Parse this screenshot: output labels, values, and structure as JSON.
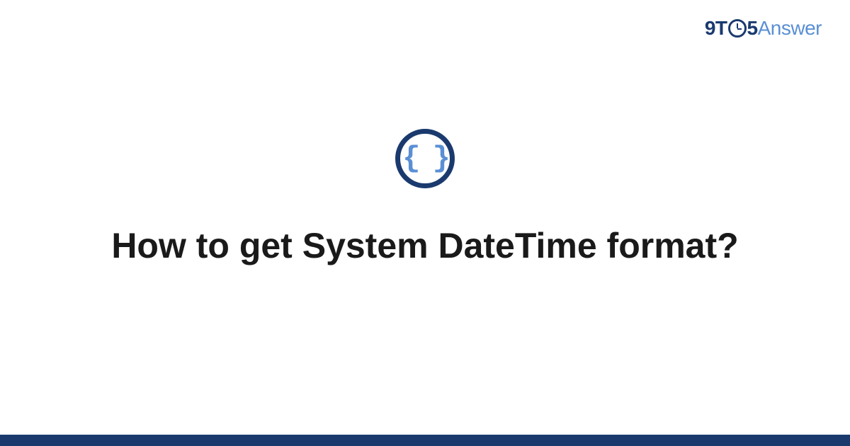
{
  "logo": {
    "part1": "9T",
    "part2": "5",
    "part3": "Answer"
  },
  "icon": {
    "name": "code-braces",
    "glyph": "{ }"
  },
  "title": "How to get System DateTime format?",
  "colors": {
    "primary": "#1a3a6e",
    "accent": "#5a8fd4"
  }
}
